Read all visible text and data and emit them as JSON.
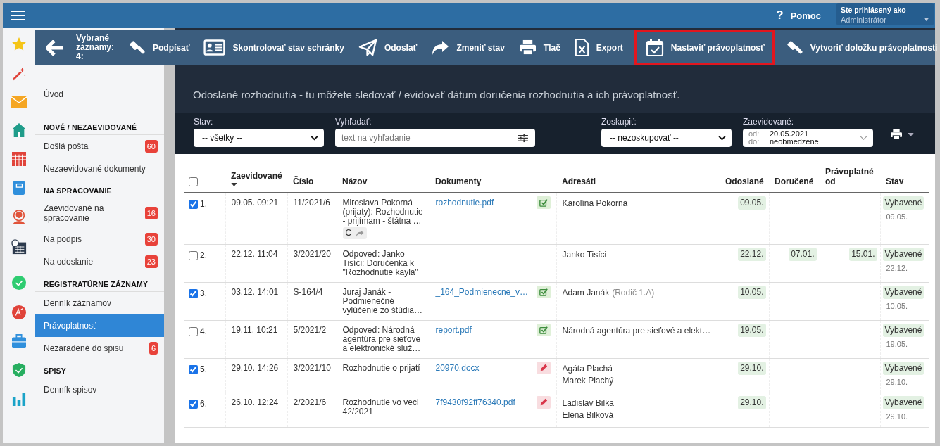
{
  "top_bar": {
    "help_icon": "?",
    "help_label": "Pomoc",
    "user_caption": "Ste prihlásený ako",
    "user_name": "Administrátor"
  },
  "toolbar": {
    "selection_text": "Vybrané záznamy: 4:",
    "actions": [
      {
        "label": "Podpísať",
        "highlighted": false
      },
      {
        "label": "Skontrolovať stav schránky",
        "highlighted": false
      },
      {
        "label": "Odoslať",
        "highlighted": false
      },
      {
        "label": "Zmeniť stav",
        "highlighted": false
      },
      {
        "label": "Tlač",
        "highlighted": false
      },
      {
        "label": "Export",
        "highlighted": false
      },
      {
        "label": "Nastaviť právoplatnosť",
        "highlighted": true
      },
      {
        "label": "Vytvoriť doložku právoplatnosti",
        "highlighted": false
      }
    ]
  },
  "sidebar": {
    "sections": [
      {
        "items": [
          {
            "label": "Úvod",
            "selected": false
          }
        ]
      },
      {
        "title": "NOVÉ / NEZAEVIDOVANÉ",
        "items": [
          {
            "label": "Došlá pošta",
            "badge": "60",
            "selected": false
          },
          {
            "label": "Nezaevidované dokumenty",
            "selected": false
          }
        ]
      },
      {
        "title": "NA SPRACOVANIE",
        "items": [
          {
            "label": "Zaevidované na spracovanie",
            "badge": "16",
            "selected": false
          },
          {
            "label": "Na podpis",
            "badge": "30",
            "selected": false
          },
          {
            "label": "Na odoslanie",
            "badge": "23",
            "selected": false
          }
        ]
      },
      {
        "title": "REGISTRATÚRNE ZÁZNAMY",
        "items": [
          {
            "label": "Denník záznamov",
            "selected": false
          },
          {
            "label": "Právoplatnosť",
            "selected": true
          },
          {
            "label": "Nezaradené do spisu",
            "badge": "6",
            "selected": false
          }
        ]
      },
      {
        "title": "SPISY",
        "items": [
          {
            "label": "Denník spisov",
            "selected": false
          }
        ]
      }
    ]
  },
  "page_header": {
    "subtitle": "Odoslané rozhodnutia - tu môžete sledovať / evidovať dátum doručenia rozhodnutia a ich právoplatnosť."
  },
  "filters": [
    {
      "kind": "select",
      "label": "Stav:",
      "value": "-- všetky --"
    },
    {
      "kind": "search",
      "label": "Vyhľadať:",
      "placeholder": "text na vyhľadanie"
    },
    {
      "kind": "select",
      "label": "Zoskupiť:",
      "value": "-- nezoskupovať --"
    },
    {
      "kind": "date_range",
      "label": "Zaevidované:",
      "from_label": "od:",
      "from": "20.05.2021",
      "to_label": "do:",
      "to": "neobmedzene"
    }
  ],
  "table": {
    "select_all": {
      "checked": false
    },
    "columns": [
      "Zaevidované",
      "Číslo",
      "Názov",
      "Dokumenty",
      "Adresáti",
      "Odoslané",
      "Doručené",
      "Právoplatné od",
      "Stav"
    ],
    "rows": [
      {
        "checked": true,
        "number": "1.",
        "registered": "09.05. 09:21",
        "number_ref": "11/2021/6",
        "title": "Miroslava Pokorná (prijaty): Rozhodnutie - prijímam - štátna …",
        "tag": {
          "label": "C",
          "forwarded": true
        },
        "document": "rozhodnutie.pdf",
        "document_signed": true,
        "recipients": [
          {
            "name": "Karolína Pokorná"
          }
        ],
        "sent": "09.05.",
        "status": "Vybavené",
        "status_date": "09.05."
      },
      {
        "checked": false,
        "number": "2.",
        "registered": "22.12. 11:04",
        "number_ref": "3/2021/20",
        "title": "Odpoveď: Janko Tisíci: Doručenka k \"Rozhodnutie kayla\"",
        "recipients": [
          {
            "name": "Janko Tisíci"
          }
        ],
        "sent": "22.12.",
        "delivered": "07.01.",
        "effective_from": "15.01.",
        "status": "Vybavené",
        "status_date": "22.12."
      },
      {
        "checked": true,
        "number": "3.",
        "registered": "03.12. 14:01",
        "number_ref": "S-164/4",
        "title": "Juraj Janák - Podmienečné vylúčenie zo štúdia…",
        "document": "_164_Podmienecne_v…",
        "document_signed": true,
        "recipients": [
          {
            "name": "Adam Janák",
            "note": "(Rodič 1.A)"
          }
        ],
        "sent": "10.05.",
        "status": "Vybavené",
        "status_date": "10.05."
      },
      {
        "checked": false,
        "number": "4.",
        "registered": "19.11. 10:21",
        "number_ref": "5/2021/2",
        "title": "Odpoveď: Národná agentúra pre sieťové a elektronické služ…",
        "document": "report.pdf",
        "document_signed": true,
        "recipients": [
          {
            "name": "Národná agentúra pre sieťové a elekt…"
          }
        ],
        "sent": "19.05.",
        "status": "Vybavené",
        "status_date": "19.05."
      },
      {
        "checked": true,
        "number": "5.",
        "registered": "29.10. 14:26",
        "number_ref": "3/2021/10",
        "title": "Rozhodnutie o prijatí",
        "document": "20970.docx",
        "document_signed": false,
        "recipients": [
          {
            "name": "Agáta Plachá"
          },
          {
            "name": "Marek Plachý"
          }
        ],
        "sent": "29.10.",
        "status": "Vybavené",
        "status_date": "29.10."
      },
      {
        "checked": true,
        "number": "6.",
        "registered": "26.10. 12:24",
        "number_ref": "2/2021/6",
        "title": "Rozhodnutie vo veci 42/2021",
        "document": "7f9430f92ff76340.pdf",
        "document_signed": false,
        "recipients": [
          {
            "name": "Ladislav Bilka"
          },
          {
            "name": "Elena Bilková"
          }
        ],
        "sent": "29.10.",
        "status": "Vybavené",
        "status_date": "29.10."
      }
    ]
  }
}
